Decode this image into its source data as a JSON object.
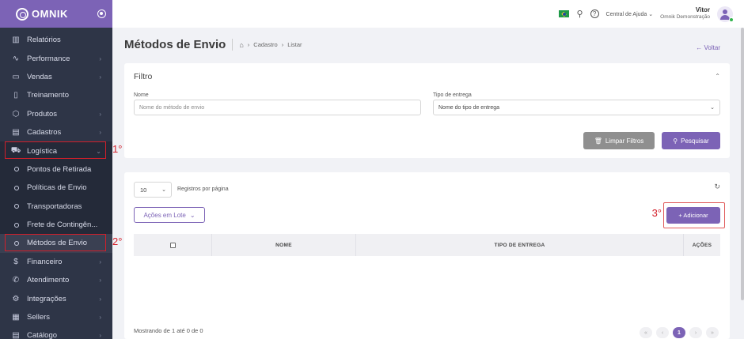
{
  "brand": {
    "name": "omnik"
  },
  "sidebar": {
    "items": [
      {
        "label": "Relatórios",
        "icon": "bar-chart-icon",
        "glyph": "▥",
        "chevron": false
      },
      {
        "label": "Performance",
        "icon": "activity-icon",
        "glyph": "∿",
        "chevron": true
      },
      {
        "label": "Vendas",
        "icon": "wallet-icon",
        "glyph": "▭",
        "chevron": true
      },
      {
        "label": "Treinamento",
        "icon": "book-icon",
        "glyph": "▯",
        "chevron": false
      },
      {
        "label": "Produtos",
        "icon": "box-icon",
        "glyph": "⬡",
        "chevron": true
      },
      {
        "label": "Cadastros",
        "icon": "clipboard-icon",
        "glyph": "▤",
        "chevron": true
      },
      {
        "label": "Logística",
        "icon": "truck-icon",
        "glyph": "⛟",
        "chevron": true,
        "expanded": true
      },
      {
        "label": "Pontos de Retirada",
        "sub": true
      },
      {
        "label": "Políticas de Envio",
        "sub": true
      },
      {
        "label": "Transportadoras",
        "sub": true
      },
      {
        "label": "Frete de Contingên...",
        "sub": true
      },
      {
        "label": "Métodos de Envio",
        "sub": true,
        "current": true
      },
      {
        "label": "Financeiro",
        "icon": "dollar-icon",
        "glyph": "$",
        "chevron": true
      },
      {
        "label": "Atendimento",
        "icon": "phone-icon",
        "glyph": "✆",
        "chevron": true
      },
      {
        "label": "Integrações",
        "icon": "settings-icon",
        "glyph": "⚙",
        "chevron": true
      },
      {
        "label": "Sellers",
        "icon": "store-icon",
        "glyph": "▦",
        "chevron": true
      },
      {
        "label": "Catálogo",
        "icon": "catalog-icon",
        "glyph": "▤",
        "chevron": true
      }
    ],
    "markers": {
      "logistica": "1°",
      "metodos": "2°"
    }
  },
  "topbar": {
    "help_label": "Central de Ajuda",
    "user_name": "Vitor",
    "user_company": "Omnik Demonstração"
  },
  "page": {
    "title": "Métodos de Envio",
    "breadcrumb": [
      "Cadastro",
      "Listar"
    ],
    "back_label": "Voltar"
  },
  "filter": {
    "title": "Filtro",
    "name_label": "Nome",
    "name_placeholder": "Nome do método de envio",
    "type_label": "Tipo de entrega",
    "type_value": "Nome do tipo de entrega",
    "clear_label": "Limpar Filtros",
    "search_label": "Pesquisar"
  },
  "list": {
    "per_page_value": "10",
    "per_page_label": "Registros por página",
    "bulk_label": "Ações em Lote",
    "add_label": "+ Adicionar",
    "add_marker": "3°",
    "columns": [
      "NOME",
      "TIPO DE ENTREGA",
      "AÇÕES"
    ],
    "showing": "Mostrando de 1 até 0 de 0",
    "current_page": "1"
  },
  "colors": {
    "accent": "#7c63b6",
    "sidebar": "#2e3547",
    "highlight": "#d31f2a"
  }
}
